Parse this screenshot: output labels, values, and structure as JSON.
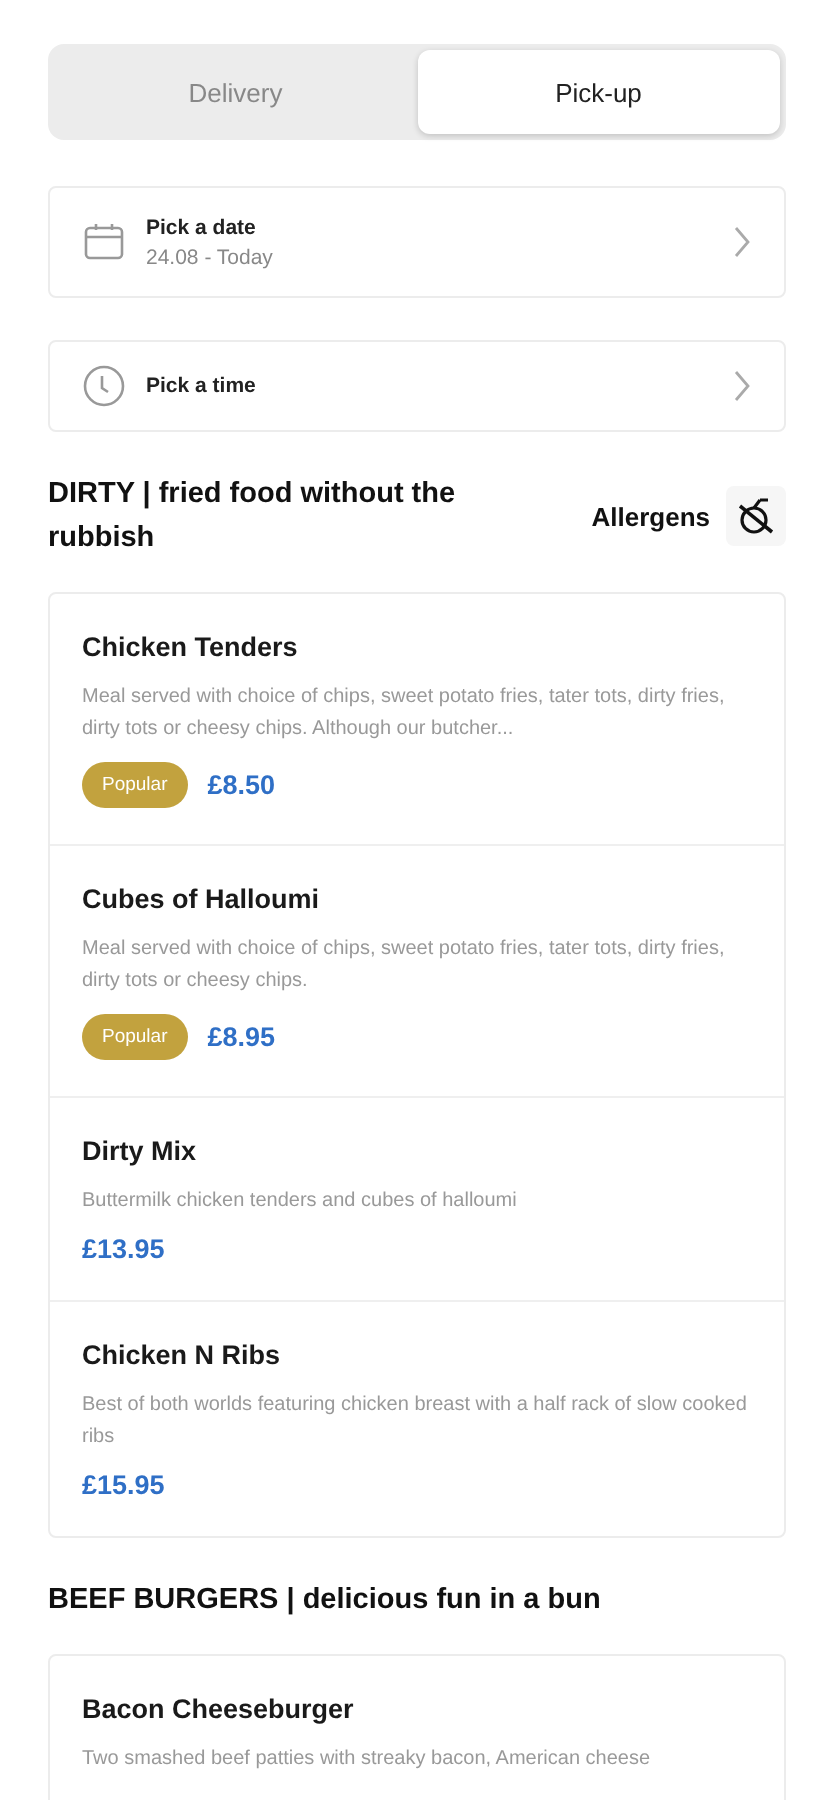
{
  "tabs": [
    {
      "label": "Delivery",
      "selected": false
    },
    {
      "label": "Pick-up",
      "selected": true
    }
  ],
  "pickers": [
    {
      "kind": "date",
      "label": "Pick a date",
      "value": "24.08 - Today"
    },
    {
      "kind": "time",
      "label": "Pick a time"
    }
  ],
  "sections": [
    {
      "title": "DIRTY | fried food without the rubbish",
      "allergens_label": "Allergens",
      "items": [
        {
          "name": "Chicken Tenders",
          "description": "Meal served with choice of chips, sweet potato fries, tater tots, dirty fries, dirty tots or cheesy chips. Although our butcher...",
          "badge": "Popular",
          "price": "£8.50"
        },
        {
          "name": "Cubes of Halloumi",
          "description": "Meal served with choice of chips, sweet potato fries, tater tots, dirty fries, dirty tots or cheesy chips.",
          "badge": "Popular",
          "price": "£8.95"
        },
        {
          "name": "Dirty Mix",
          "description": "Buttermilk chicken tenders and cubes of halloumi",
          "price": "£13.95"
        },
        {
          "name": "Chicken N Ribs",
          "description": "Best of both worlds featuring chicken breast with a half rack of slow cooked ribs",
          "price": "£15.95"
        }
      ]
    },
    {
      "title": "BEEF BURGERS | delicious fun in a bun",
      "items": [
        {
          "name": "Bacon Cheeseburger",
          "description": "Two smashed beef patties with streaky bacon, American cheese"
        }
      ]
    }
  ]
}
